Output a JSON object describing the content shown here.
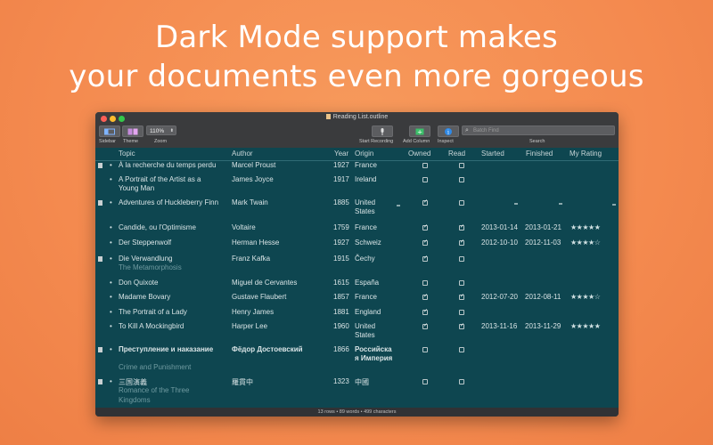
{
  "headline": {
    "line1": "Dark Mode support makes",
    "line2": "your documents even more gorgeous"
  },
  "window": {
    "title": "Reading List.outline",
    "toolbar": {
      "sidebar_label": "Sidebar",
      "theme_label": "Theme",
      "zoom_value": "110%",
      "zoom_label": "Zoom",
      "start_recording_label": "Start Recording",
      "add_column_label": "Add Column",
      "inspect_label": "Inspect",
      "search_placeholder": "Batch Find",
      "search_label": "Search"
    },
    "columns": [
      "Topic",
      "Author",
      "Year",
      "Origin",
      "Owned",
      "Read",
      "Started",
      "Finished",
      "My Rating"
    ],
    "rows": [
      {
        "topic": "À la recherche du temps perdu",
        "author": "Marcel Proust",
        "year": "1927",
        "origin": "France",
        "owned": false,
        "read": false,
        "started": "",
        "finished": "",
        "rating": "",
        "handle": true
      },
      {
        "topic": "A Portrait of the Artist as a",
        "topic2": "Young Man",
        "author": "James Joyce",
        "year": "1917",
        "origin": "Ireland",
        "owned": false,
        "read": false,
        "started": "",
        "finished": "",
        "rating": "",
        "handle": false
      },
      {
        "topic": "Adventures of Huckleberry Finn",
        "author": "Mark Twain",
        "year": "1885",
        "origin": "United",
        "origin2": "States",
        "owned": true,
        "read": false,
        "started": "",
        "finished": "",
        "rating": "",
        "handle": true
      },
      {
        "topic": "Candide, ou l'Optimisme",
        "author": "Voltaire",
        "year": "1759",
        "origin": "France",
        "owned": true,
        "read": true,
        "started": "2013-01-14",
        "finished": "2013-01-21",
        "rating": "★★★★★",
        "handle": false
      },
      {
        "topic": "Der Steppenwolf",
        "author": "Herman Hesse",
        "year": "1927",
        "origin": "Schweiz",
        "owned": true,
        "read": true,
        "started": "2012-10-10",
        "finished": "2012-11-03",
        "rating": "★★★★☆",
        "handle": false
      },
      {
        "topic": "Die Verwandlung",
        "subtitle": "The Metamorphosis",
        "author": "Franz Kafka",
        "year": "1915",
        "origin": "Čechy",
        "owned": true,
        "read": false,
        "started": "",
        "finished": "",
        "rating": "",
        "handle": true
      },
      {
        "topic": "Don Quixote",
        "author": "Miguel de Cervantes",
        "year": "1615",
        "origin": "España",
        "owned": false,
        "read": false,
        "started": "",
        "finished": "",
        "rating": "",
        "handle": false
      },
      {
        "topic": "Madame Bovary",
        "author": "Gustave Flaubert",
        "year": "1857",
        "origin": "France",
        "owned": true,
        "read": true,
        "started": "2012-07-20",
        "finished": "2012-08-11",
        "rating": "★★★★☆",
        "handle": false
      },
      {
        "topic": "The Portrait of a Lady",
        "author": "Henry James",
        "year": "1881",
        "origin": "England",
        "owned": true,
        "read": false,
        "started": "",
        "finished": "",
        "rating": "",
        "handle": false
      },
      {
        "topic": "To Kill A Mockingbird",
        "author": "Harper Lee",
        "year": "1960",
        "origin": "United",
        "origin2": "States",
        "owned": true,
        "read": true,
        "started": "2013-11-16",
        "finished": "2013-11-29",
        "rating": "★★★★★",
        "handle": false
      },
      {
        "topic": "Преступление и наказание",
        "subtitle": "Crime and Punishment",
        "author": "Фёдор Достоевский",
        "year": "1866",
        "origin": "Российска",
        "origin2": "я Империя",
        "owned": false,
        "read": false,
        "started": "",
        "finished": "",
        "rating": "",
        "handle": true,
        "bold": true
      },
      {
        "topic": "三国演義",
        "subtitle": "Romance of the Three",
        "subtitle2": "Kingdoms",
        "author": "羅貫中",
        "year": "1323",
        "origin": "中國",
        "owned": false,
        "read": false,
        "started": "",
        "finished": "",
        "rating": "",
        "handle": true
      }
    ],
    "status": "13 rows • 89 words • 499 characters"
  }
}
